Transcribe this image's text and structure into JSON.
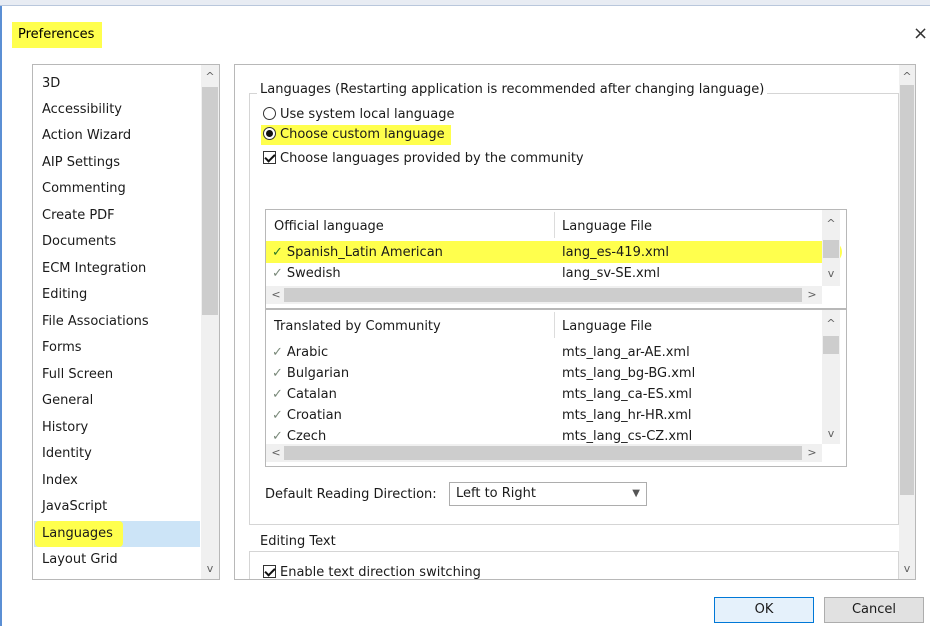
{
  "window": {
    "title": "Preferences",
    "close_glyph": "×"
  },
  "categories": {
    "items": [
      "3D",
      "Accessibility",
      "Action Wizard",
      "AIP Settings",
      "Commenting",
      "Create PDF",
      "Documents",
      "ECM Integration",
      "Editing",
      "File Associations",
      "Forms",
      "Full Screen",
      "General",
      "History",
      "Identity",
      "Index",
      "JavaScript",
      "Languages",
      "Layout Grid"
    ],
    "selected": "Languages"
  },
  "languages": {
    "group_label": "Languages (Restarting application is recommended after changing language)",
    "radio_system": "Use system local language",
    "radio_custom": "Choose custom language",
    "community_checkbox": "Choose languages provided by the community",
    "official_table": {
      "col1": "Official language",
      "col2": "Language File",
      "rows": [
        {
          "name": "Spanish_Latin American",
          "file": "lang_es-419.xml"
        },
        {
          "name": "Swedish",
          "file": "lang_sv-SE.xml"
        }
      ]
    },
    "community_table": {
      "col1": "Translated by Community",
      "col2": "Language File",
      "rows": [
        {
          "name": "Arabic",
          "file": "mts_lang_ar-AE.xml"
        },
        {
          "name": "Bulgarian",
          "file": "mts_lang_bg-BG.xml"
        },
        {
          "name": "Catalan",
          "file": "mts_lang_ca-ES.xml"
        },
        {
          "name": "Croatian",
          "file": "mts_lang_hr-HR.xml"
        },
        {
          "name": "Czech",
          "file": "mts_lang_cs-CZ.xml"
        }
      ]
    },
    "reading_direction_label": "Default Reading Direction:",
    "reading_direction_value": "Left to Right"
  },
  "editing_text": {
    "group_label": "Editing Text",
    "direction_switch_checkbox": "Enable text direction switching"
  },
  "buttons": {
    "ok": "OK",
    "cancel": "Cancel"
  },
  "colors": {
    "highlight": "#ffff4d",
    "selection": "#cce4f7",
    "window_border": "#5b8fd4",
    "default_button_border": "#0078d7"
  },
  "icons": {
    "check_mark": "✓",
    "up_arrow": "^",
    "down_arrow": "v",
    "left_arrow": "<",
    "right_arrow": ">",
    "dropdown": "▼"
  }
}
